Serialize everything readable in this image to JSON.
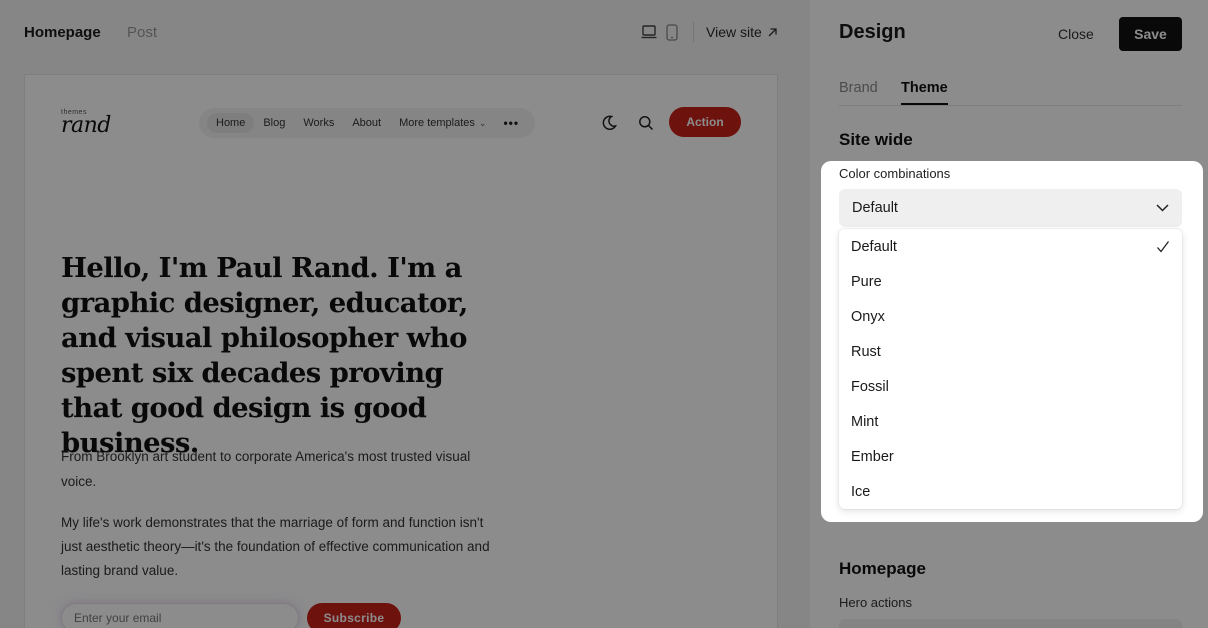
{
  "editor": {
    "tabs": [
      "Homepage",
      "Post"
    ],
    "view_site": "View site"
  },
  "preview": {
    "logo_small": "themes",
    "logo_big": "rand",
    "nav": [
      "Home",
      "Blog",
      "Works",
      "About",
      "More templates"
    ],
    "nav_more": "•••",
    "action": "Action",
    "hero_title": "Hello, I'm Paul Rand. I'm a graphic designer, educator, and visual philosopher who spent six decades proving that good design is good business.",
    "p1": "From Brooklyn art student to corporate America's most trusted visual voice.",
    "p2": "My life's work demonstrates that the marriage of form and function isn't just aesthetic theory—it's the foundation of effective communication and lasting brand value.",
    "email_placeholder": "Enter your email",
    "subscribe": "Subscribe",
    "accent": "#c8211a"
  },
  "panel": {
    "title": "Design",
    "close": "Close",
    "save": "Save",
    "tabs": [
      "Brand",
      "Theme"
    ],
    "active_tab": "Theme",
    "site_wide": "Site wide",
    "color_label": "Color combinations",
    "selected": "Default",
    "options": [
      "Default",
      "Pure",
      "Onyx",
      "Rust",
      "Fossil",
      "Mint",
      "Ember",
      "Ice"
    ],
    "homepage": "Homepage",
    "hero_actions": "Hero actions"
  }
}
